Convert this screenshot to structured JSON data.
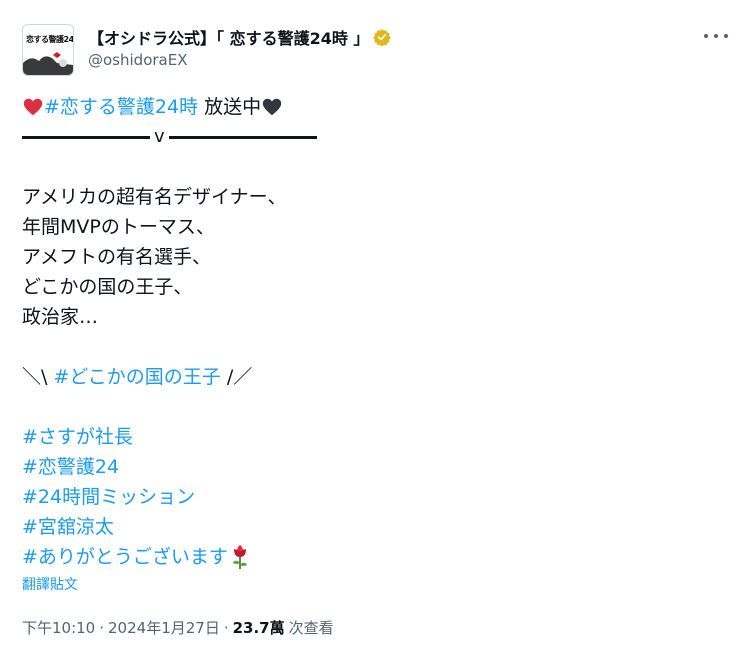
{
  "header": {
    "avatar_text": "恋する警護24時",
    "display_name": "【オシドラ公式】「 恋する警護24時 」",
    "handle": "@oshidoraEX"
  },
  "tweet": {
    "heading_hashtag": "#恋する警護24時",
    "heading_suffix": " 放送中",
    "divider_mark": "v",
    "lines": [
      "アメリカの超有名デザイナー、",
      "年間MVPのトーマス、",
      "アメフトの有名選手、",
      "どこかの国の王子、",
      "政治家…"
    ],
    "callout_prefix": "＼\\ ",
    "callout_hashtag": "#どこかの国の王子",
    "callout_suffix": " /／",
    "hashtags": [
      "#さすが社長",
      "#恋警護24",
      "#24時間ミッション",
      "#宮舘涼太",
      "#ありがとうございます"
    ]
  },
  "translate_label": "翻譯貼文",
  "meta": {
    "time": "下午10:10",
    "separator": "·",
    "date": "2024年1月27日",
    "views_count": "23.7萬",
    "views_label": "次查看"
  },
  "colors": {
    "link": "#1d9bf0",
    "text": "#0f1419",
    "secondary": "#536471",
    "heart_red": "#dd2e44",
    "heart_black": "#31373d",
    "verified_gold": "#e2b719"
  },
  "icons": [
    "verified-badge-icon",
    "more-options-icon",
    "red-heart-icon",
    "black-heart-icon",
    "rose-icon"
  ]
}
